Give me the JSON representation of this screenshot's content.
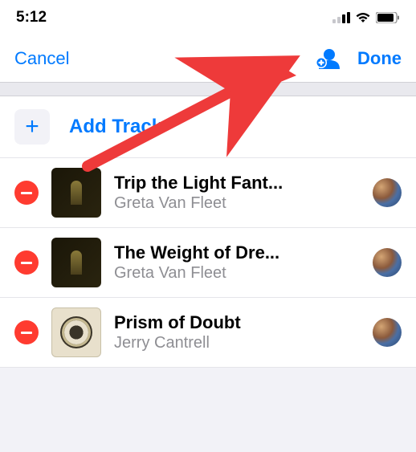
{
  "status": {
    "time": "5:12"
  },
  "nav": {
    "cancel": "Cancel",
    "done": "Done"
  },
  "add_track": {
    "label": "Add Track"
  },
  "tracks": [
    {
      "title": "Trip the Light Fant...",
      "artist": "Greta Van Fleet",
      "art": "dark"
    },
    {
      "title": "The Weight of Dre...",
      "artist": "Greta Van Fleet",
      "art": "dark"
    },
    {
      "title": "Prism of Doubt",
      "artist": "Jerry Cantrell",
      "art": "light"
    }
  ],
  "colors": {
    "accent": "#007aff",
    "destructive": "#ff3b30"
  }
}
